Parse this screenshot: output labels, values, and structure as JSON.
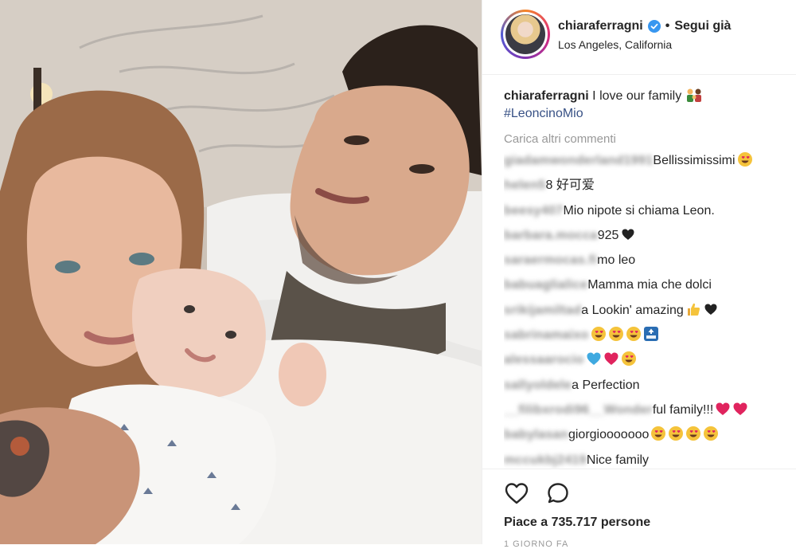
{
  "header": {
    "username": "chiaraferragni",
    "separator": "•",
    "follow_status": "Segui già",
    "location": "Los Angeles, California"
  },
  "caption": {
    "username": "chiaraferragni",
    "text": "I love our family",
    "hashtag": "#LeoncinoMio",
    "emoji": "family-emoji"
  },
  "load_more": "Carica altri commenti",
  "comments": [
    {
      "user": "giadamwonderland1991",
      "text": "Bellissimissimi",
      "emojis": [
        "heart-eyes"
      ]
    },
    {
      "user": "helen5",
      "text": "8 好可爱",
      "emojis": []
    },
    {
      "user": "beesy407",
      "text": "Mio nipote si chiama Leon.",
      "emojis": []
    },
    {
      "user": "barbara.mocca",
      "text": "925",
      "emojis": [
        "black-heart"
      ]
    },
    {
      "user": "saraermocas.fi",
      "text": "mo leo",
      "emojis": []
    },
    {
      "user": "babuaglialice",
      "text": "Mamma mia che dolci",
      "emojis": []
    },
    {
      "user": "srikijamiltad",
      "text": "a Lookin' amazing",
      "emojis": [
        "thumbs-up",
        "black-heart"
      ]
    },
    {
      "user": "sabrinamaixo",
      "text": "",
      "emojis": [
        "heart-eyes",
        "heart-eyes",
        "heart-eyes",
        "top-arrow"
      ]
    },
    {
      "user": "alessaarocio",
      "text": "",
      "emojis": [
        "blue-heart",
        "red-heart",
        "heart-eyes"
      ]
    },
    {
      "user": "sallyoldele",
      "text": "a Perfection",
      "emojis": []
    },
    {
      "user": "__filibxrodi96__Wonder",
      "text": "ful family!!!",
      "emojis": [
        "red-heart",
        "red-heart"
      ]
    },
    {
      "user": "babylasan",
      "text": "giorgiooooooo",
      "emojis": [
        "heart-eyes",
        "heart-eyes",
        "heart-eyes",
        "heart-eyes"
      ]
    },
    {
      "user": "mccukbj2419",
      "text": "Nice family",
      "emojis": []
    }
  ],
  "likes": "Piace a 735.717 persone",
  "timestamp": "1 GIORNO FA",
  "colors": {
    "link": "#385185",
    "verified": "#3897f0",
    "muted": "#999999",
    "red_heart": "#ed4956"
  },
  "icons": [
    "verified-badge-icon",
    "like-heart-icon",
    "comment-bubble-icon"
  ]
}
